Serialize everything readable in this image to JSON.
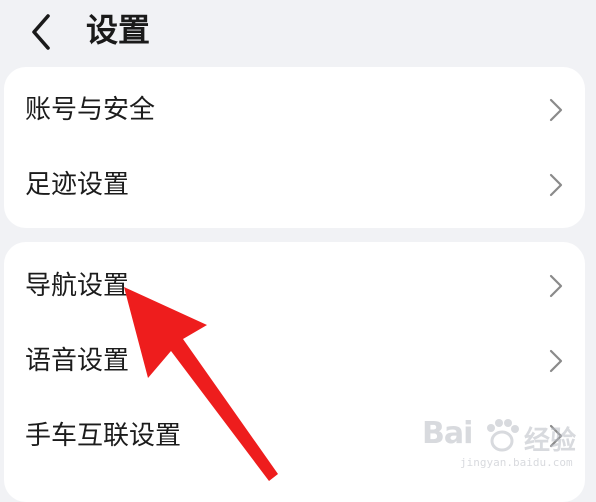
{
  "header": {
    "title": "设置",
    "back_icon": "chevron-left-icon"
  },
  "groups": [
    {
      "items": [
        {
          "label": "账号与安全",
          "icon": "chevron-right-icon"
        },
        {
          "label": "足迹设置",
          "icon": "chevron-right-icon"
        }
      ]
    },
    {
      "items": [
        {
          "label": "导航设置",
          "icon": "chevron-right-icon"
        },
        {
          "label": "语音设置",
          "icon": "chevron-right-icon"
        },
        {
          "label": "手车互联设置",
          "icon": "chevron-right-icon"
        }
      ]
    }
  ],
  "annotation": {
    "type": "red-arrow",
    "target": "导航设置",
    "color": "#ee1d1d"
  },
  "watermark": {
    "logo": "Bai",
    "suffix": "经验",
    "url": "jingyan.baidu.com"
  },
  "colors": {
    "background": "#f1f2f5",
    "card": "#ffffff",
    "text": "#1c1c1c",
    "chevron": "#8a8a8a",
    "arrow": "#ee1d1d"
  }
}
